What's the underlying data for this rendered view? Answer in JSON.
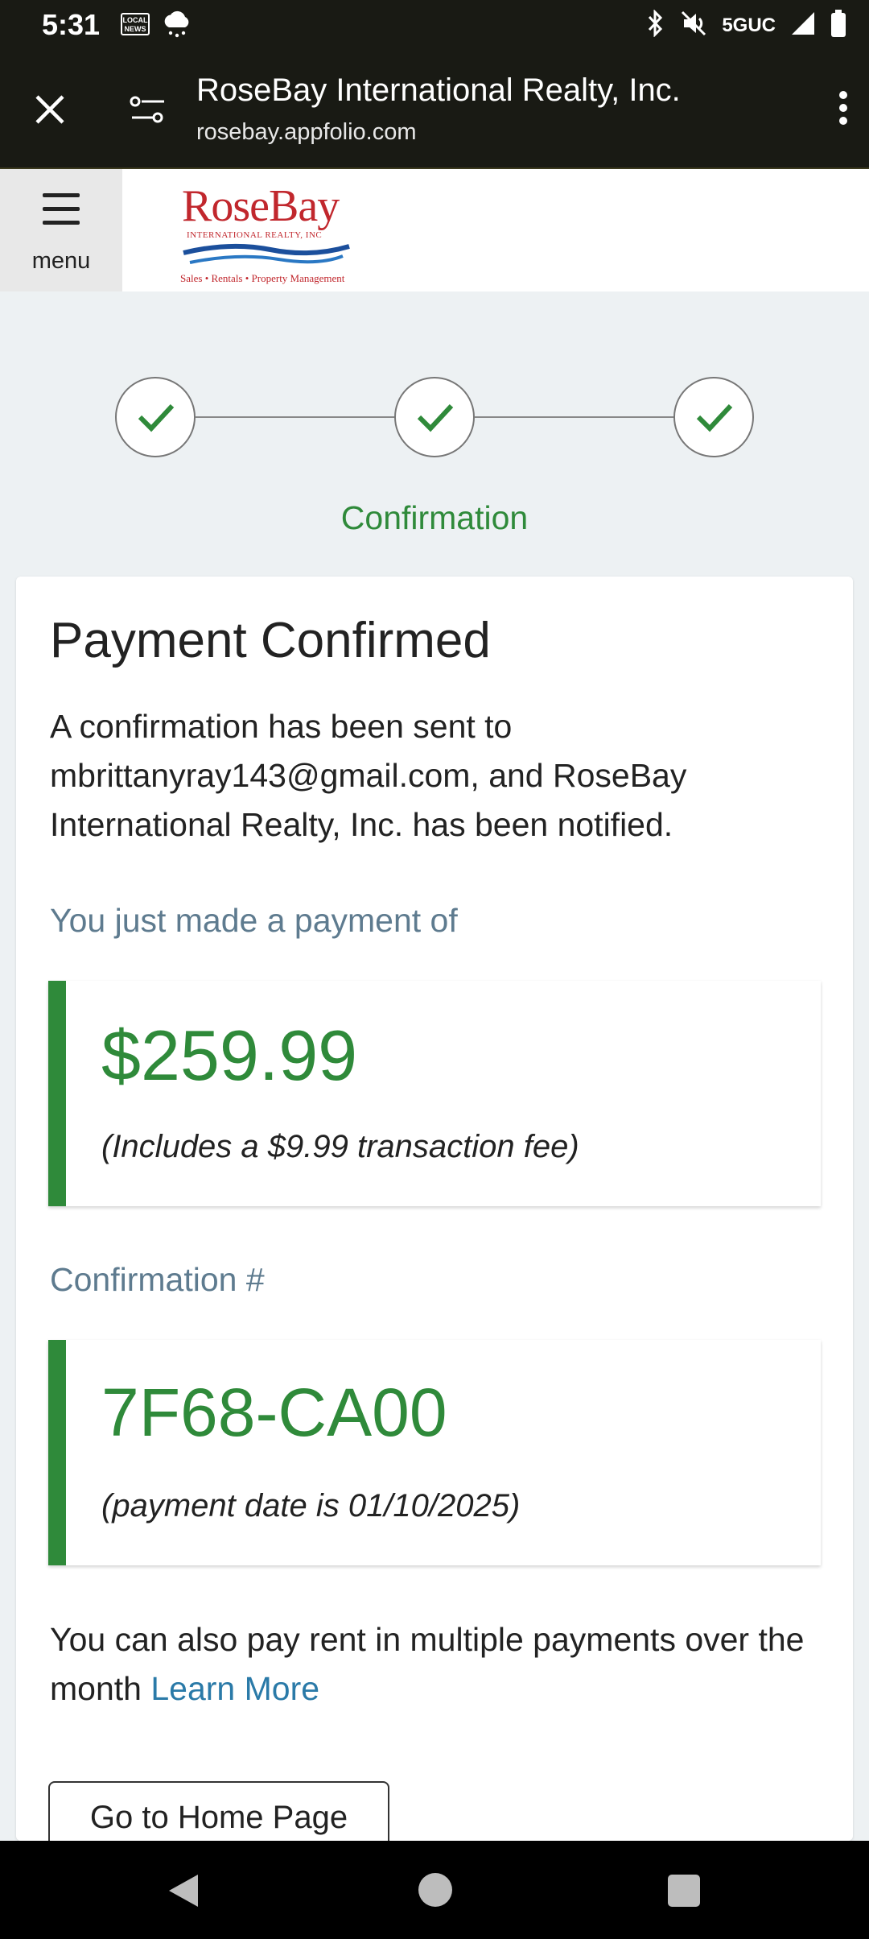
{
  "status_bar": {
    "time": "5:31",
    "news_icon_text": "LOCAL NEWS",
    "network": "5GUC"
  },
  "browser": {
    "title": "RoseBay International Realty, Inc.",
    "url": "rosebay.appfolio.com"
  },
  "header": {
    "menu_label": "menu",
    "logo": {
      "name": "RoseBay",
      "subtitle": "INTERNATIONAL REALTY, INC",
      "tagline": "Sales • Rentals • Property Management"
    }
  },
  "stepper": {
    "current_label": "Confirmation",
    "steps_completed": 3
  },
  "confirmation": {
    "title": "Payment Confirmed",
    "description": "A confirmation has been sent to mbrittanyray143@gmail.com, and RoseBay International Realty, Inc. has been notified.",
    "payment_label": "You just made a payment of",
    "amount": "$259.99",
    "fee_note": "(Includes a $9.99 transaction fee)",
    "confirmation_label": "Confirmation #",
    "confirmation_number": "7F68-CA00",
    "date_note": "(payment date is 01/10/2025)",
    "multi_pay_text": "You can also pay rent in multiple payments over the month",
    "learn_more": "Learn More",
    "home_button": "Go to Home Page"
  },
  "colors": {
    "accent_green": "#2f8a3a",
    "link_blue": "#2a7aa8",
    "brand_red": "#c1272d",
    "browser_bar": "#191a14"
  }
}
